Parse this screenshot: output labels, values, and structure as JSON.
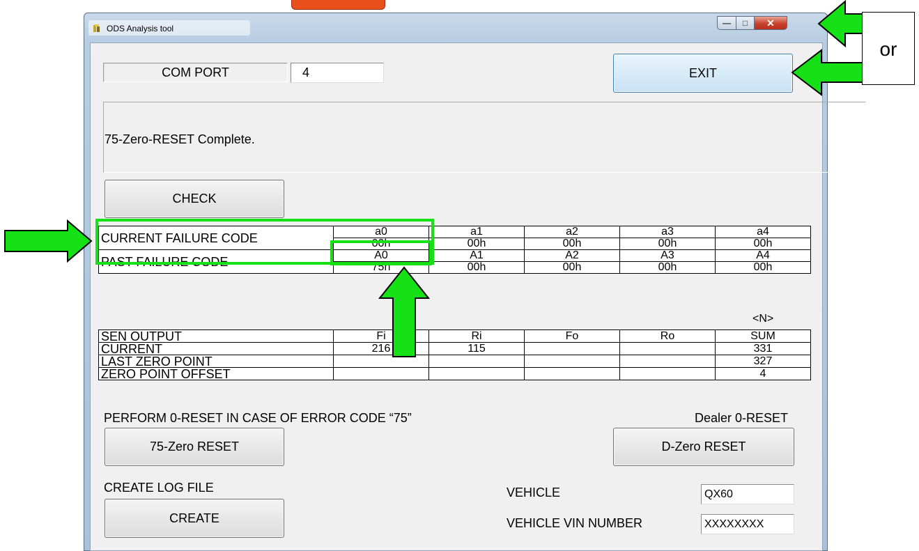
{
  "window": {
    "title": "ODS Analysis tool"
  },
  "com_port": {
    "label": "COM PORT",
    "value": "4"
  },
  "exit_label": "EXIT",
  "status_message": "75-Zero-RESET Complete.",
  "check_label": "CHECK",
  "failure_table": {
    "current_label": "CURRENT FAILURE CODE",
    "past_label": "PAST FAILURE CODE",
    "current_headers": [
      "a0",
      "a1",
      "a2",
      "a3",
      "a4"
    ],
    "current_values": [
      "00h",
      "00h",
      "00h",
      "00h",
      "00h"
    ],
    "past_headers": [
      "A0",
      "A1",
      "A2",
      "A3",
      "A4"
    ],
    "past_values": [
      "75h",
      "00h",
      "00h",
      "00h",
      "00h"
    ]
  },
  "unit_label": "<N>",
  "sensor_table": {
    "headers": [
      "SEN OUTPUT",
      "Fi",
      "Ri",
      "Fo",
      "Ro",
      "SUM"
    ],
    "rows": [
      [
        "CURRENT",
        "216",
        "115",
        "",
        "",
        "331"
      ],
      [
        "LAST ZERO POINT",
        "",
        "",
        "",
        "",
        "327"
      ],
      [
        "ZERO POINT OFFSET",
        "",
        "",
        "",
        "",
        "4"
      ]
    ]
  },
  "perform_reset_text": "PERFORM 0-RESET IN CASE OF ERROR CODE “75”",
  "dealer_reset_text": "Dealer 0-RESET",
  "zero_reset_75_label": "75-Zero RESET",
  "d_zero_reset_label": "D-Zero RESET",
  "create_log_label": "CREATE LOG FILE",
  "create_label": "CREATE",
  "vehicle": {
    "label": "VEHICLE",
    "value": "QX60"
  },
  "vin": {
    "label": "VEHICLE VIN NUMBER",
    "value": "XXXXXXXX"
  },
  "annotation": {
    "or_text": "or",
    "highlight_color": "#16e016"
  },
  "icons": [
    "app-icon",
    "minimize-icon",
    "maximize-icon",
    "close-icon",
    "green-arrow-icon"
  ]
}
